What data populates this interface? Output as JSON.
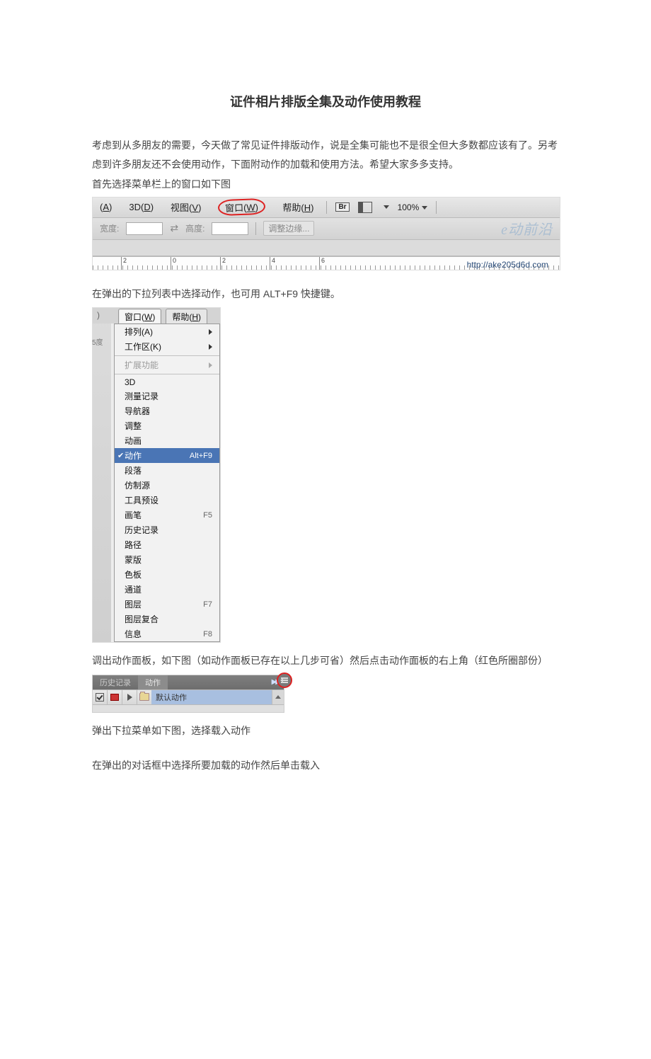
{
  "title": "证件相片排版全集及动作使用教程",
  "para1": "考虑到从多朋友的需要，今天做了常见证件排版动作，说是全集可能也不是很全但大多数都应该有了。另考虑到许多朋友还不会使用动作，下面附动作的加载和使用方法。希望大家多多支持。",
  "para1b": "首先选择菜单栏上的窗口如下图",
  "ss1": {
    "menu": {
      "a_pre": "(",
      "a_u": "A",
      "a_post": ")",
      "d_pre": "3D(",
      "d_u": "D",
      "d_post": ")",
      "v_pre": "视图(",
      "v_u": "V",
      "v_post": ")",
      "w_pre": "窗口(",
      "w_u": "W",
      "w_post": ")",
      "h_pre": "帮助(",
      "h_u": "H",
      "h_post": ")",
      "br": "Br",
      "zoom": "100%"
    },
    "opt": {
      "width": "宽度:",
      "height": "高度:",
      "adjust": "调整边缘..."
    },
    "watermark": "e动前沿",
    "ticks": [
      "2",
      "0",
      "2",
      "4",
      "6"
    ],
    "url": "http://ake205d6d.com"
  },
  "para2": "在弹出的下拉列表中选择动作，也可用 ALT+F9 快捷键。",
  "ss2": {
    "leftchar": ")",
    "sidecap": "5度",
    "tabs": {
      "w_pre": "窗口(",
      "w_u": "W",
      "w_post": ")",
      "h_pre": "帮助(",
      "h_u": "H",
      "h_post": ")"
    },
    "items": [
      {
        "label": "排列(A)",
        "type": "sub"
      },
      {
        "label": "工作区(K)",
        "type": "sub"
      },
      {
        "type": "hr"
      },
      {
        "label": "扩展功能",
        "type": "sub",
        "disabled": true
      },
      {
        "type": "hr"
      },
      {
        "label": "3D"
      },
      {
        "label": "测量记录"
      },
      {
        "label": "导航器"
      },
      {
        "label": "调整"
      },
      {
        "label": "动画"
      },
      {
        "label": "动作",
        "shortcut": "Alt+F9",
        "hilite": true,
        "checked": true
      },
      {
        "label": "段落"
      },
      {
        "label": "仿制源"
      },
      {
        "label": "工具预设"
      },
      {
        "label": "画笔",
        "shortcut": "F5"
      },
      {
        "label": "历史记录"
      },
      {
        "label": "路径"
      },
      {
        "label": "蒙版"
      },
      {
        "label": "色板"
      },
      {
        "label": "通道"
      },
      {
        "label": "图层",
        "shortcut": "F7"
      },
      {
        "label": "图层复合"
      },
      {
        "label": "信息",
        "shortcut": "F8"
      }
    ]
  },
  "para3": "调出动作面板，如下图（如动作面板已存在以上几步可省）然后点击动作面板的右上角（红色所圈部份）",
  "ss3": {
    "tab_history": "历史记录",
    "tab_actions": "动作",
    "row_label": "默认动作"
  },
  "para4": "弹出下拉菜单如下图，选择载入动作",
  "para5": "在弹出的对话框中选择所要加载的动作然后单击载入"
}
